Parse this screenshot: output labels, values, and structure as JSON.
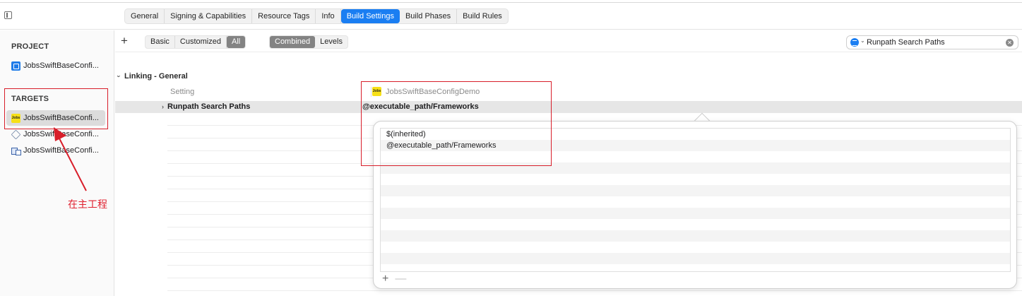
{
  "tabs": [
    "General",
    "Signing & Capabilities",
    "Resource Tags",
    "Info",
    "Build Settings",
    "Build Phases",
    "Build Rules"
  ],
  "active_tab_index": 4,
  "sidebar": {
    "project_header": "PROJECT",
    "project_item": "JobsSwiftBaseConfi...",
    "targets_header": "TARGETS",
    "targets": [
      {
        "label": "JobsSwiftBaseConfi...",
        "icon": "app-icon-jobs",
        "selected": true
      },
      {
        "label": "JobsSwiftBaseConfi...",
        "icon": "extension-icon",
        "selected": false
      },
      {
        "label": "JobsSwiftBaseConfi...",
        "icon": "test-target-icon",
        "selected": false
      }
    ],
    "app_icon_text": "Jobs"
  },
  "annotation": {
    "text": "在主工程",
    "color": "#e0202f"
  },
  "toolbar": {
    "add_label": "+",
    "filter_segments": [
      "Basic",
      "Customized",
      "All"
    ],
    "filter_active": "All",
    "view_segments": [
      "Combined",
      "Levels"
    ],
    "view_active": "Combined",
    "search_value": "Runpath Search Paths"
  },
  "settings": {
    "group_title": "Linking - General",
    "setting_column_header": "Setting",
    "target_column_header": "JobsSwiftBaseConfigDemo",
    "row_name": "Runpath Search Paths",
    "row_value": "@executable_path/Frameworks"
  },
  "popover": {
    "values": [
      "$(inherited)",
      "@executable_path/Frameworks",
      "",
      "",
      "",
      "",
      "",
      "",
      "",
      "",
      "",
      "",
      ""
    ],
    "add_label": "+",
    "remove_label": "—"
  },
  "colors": {
    "accent": "#1a7ef2",
    "annotation_red": "#d81e2a",
    "selected_row": "#e6e6e6"
  }
}
